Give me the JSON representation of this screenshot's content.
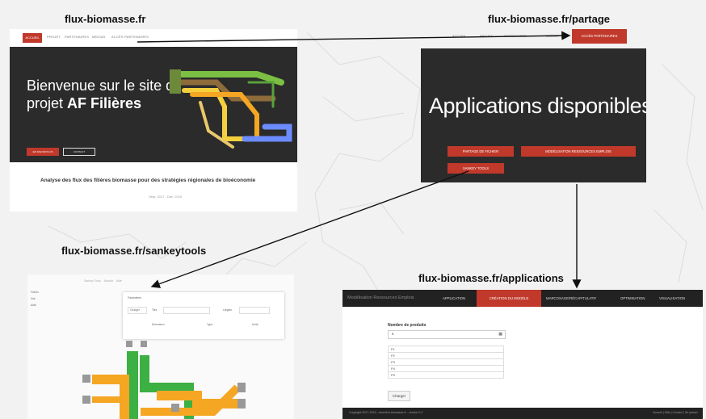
{
  "captions": {
    "home": "flux-biomasse.fr",
    "partage": "flux-biomasse.fr/partage",
    "sankeytools": "flux-biomasse.fr/sankeytools",
    "applications": "flux-biomasse.fr/applications"
  },
  "home": {
    "nav": [
      "ACCUEIL",
      "PROJET",
      "PARTENAIRES",
      "MEDIAS",
      "ACCÈS PARTENAIRES"
    ],
    "hero_line1": "Bienvenue sur le site du",
    "hero_line2_prefix": "projet ",
    "hero_line2_bold": "AF Filières",
    "hero_btn1": "EN SAVOIR PLUS",
    "hero_btn2": "CONTACT",
    "subtitle": "Analyse des flux des filières biomasse pour des stratégies régionales de bioéconomie",
    "date": "Sept. 2017 - Déc. 2019"
  },
  "partage": {
    "nav": [
      "ACCUEIL",
      "PROJET",
      "PARTENAIRES",
      "MÉDIAS"
    ],
    "nav_active": "ACCÈS PARTENAIRES",
    "title": "Applications disponibles",
    "buttons": [
      "PARTAGE DE FICHIER",
      "MODÉLISATION RESSOURCES EMPLOIS",
      "SANKEY TOOLS"
    ]
  },
  "sankeytools": {
    "top": [
      "Sankey Tools",
      "Module",
      "Aide"
    ],
    "side": [
      "Fichier",
      "Vue",
      "Aide"
    ],
    "card_title": "Paramètres",
    "load": "Charger",
    "fields": [
      "Titre",
      "Largeur",
      "Dimension",
      "Type",
      "Unité"
    ]
  },
  "applications": {
    "brand": "Modélisation Ressources Emplois",
    "nav": [
      "APPLICATION",
      "CRÉATION DU MODÈLE",
      "MARCOSAGE/RÉCAPITULATIF",
      "OPTIMISATION",
      "VISUALISATION"
    ],
    "field_label": "Nombre de produits",
    "select_value": "5",
    "products": [
      "P1",
      "P2",
      "P3",
      "P4",
      "P5"
    ],
    "charger": "Charger",
    "footer_left": "Copyright 2017-2019 - www.flux-biomasse.fr - version 0.1",
    "footer_right": "Accueil | Wiki | Contact | Se passer"
  },
  "colors": {
    "accent": "#c0392b",
    "dark": "#2b2b2b",
    "sankey_green": "#3cb043",
    "sankey_orange": "#f5a623",
    "sankey_yellow": "#f4d03f",
    "sankey_blue": "#6b8cff"
  }
}
